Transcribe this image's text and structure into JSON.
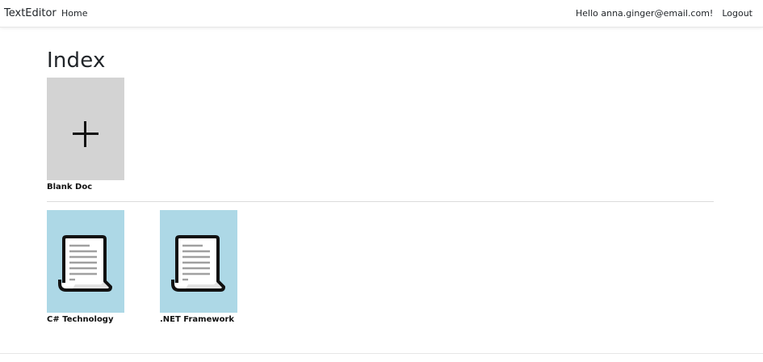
{
  "navbar": {
    "brand": "TextEditor",
    "home_label": "Home",
    "greeting": "Hello anna.ginger@email.com!",
    "logout_label": "Logout"
  },
  "page": {
    "title": "Index"
  },
  "templates": {
    "blank": {
      "label": "Blank Doc",
      "icon": "plus-icon",
      "color": "#d3d3d3"
    }
  },
  "documents": [
    {
      "label": "C# Technology",
      "icon": "document-icon",
      "color": "#add8e6"
    },
    {
      "label": ".NET Framework",
      "icon": "document-icon",
      "color": "#add8e6"
    }
  ]
}
